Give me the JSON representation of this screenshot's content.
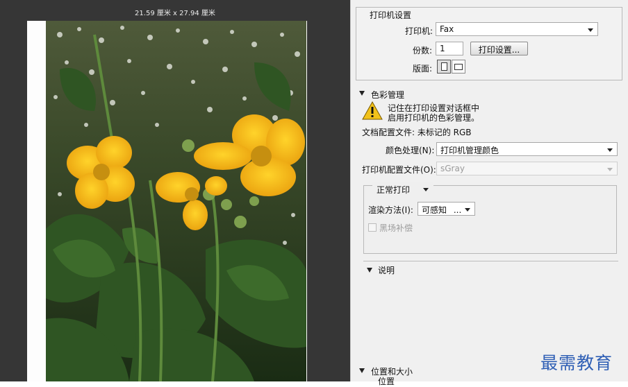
{
  "preview": {
    "dimensions": "21.59 厘米 x 27.94 厘米"
  },
  "printer_setup": {
    "title": "打印机设置",
    "printer_label": "打印机:",
    "printer_value": "Fax",
    "copies_label": "份数:",
    "copies_value": "1",
    "print_settings_button": "打印设置...",
    "layout_label": "版面:"
  },
  "color_management": {
    "title": "色彩管理",
    "warning_line1": "记住在打印设置对话框中",
    "warning_line2": "启用打印机的色彩管理。",
    "document_profile": "文档配置文件: 未标记的 RGB",
    "color_handling_label": "颜色处理(N):",
    "color_handling_value": "打印机管理颜色",
    "printer_profile_label": "打印机配置文件(O):",
    "printer_profile_value": "sGray",
    "print_mode": "正常打印",
    "rendering_label": "渲染方法(I):",
    "rendering_value": "可感知",
    "rendering_ellipsis": "...",
    "black_point_label": "黑场补偿",
    "black_point_checked": false
  },
  "description": {
    "title": "说明"
  },
  "position_size": {
    "title": "位置和大小",
    "sub": "位置"
  },
  "watermark": "最需教育",
  "icons": [
    "warning-icon",
    "portrait-layout-icon",
    "landscape-layout-icon",
    "dropdown-arrow-icon",
    "disclosure-triangle-icon"
  ],
  "colors": {
    "preview_bg": "#363636",
    "panel_bg": "#f0f0f0",
    "watermark": "#2f5fb5",
    "warning": "#f2c21b"
  }
}
